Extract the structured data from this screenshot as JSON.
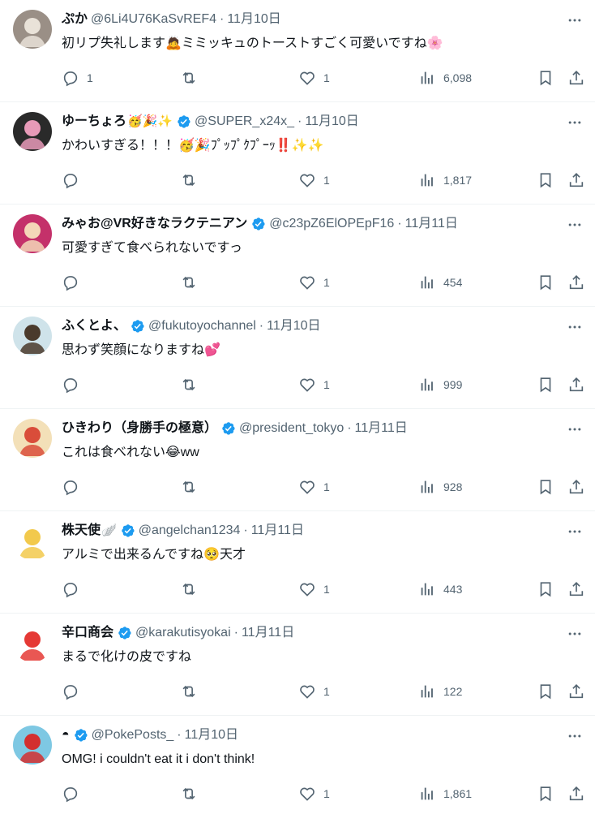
{
  "accent": "#1d9bf0",
  "tweets": [
    {
      "name": "ぷか",
      "name_emoji": "",
      "verified": false,
      "handle": "@6Li4U76KaSvREF4",
      "date": "11月10日",
      "text": "初リプ失礼します🙇ミミッキュのトーストすごく可愛いですね🌸",
      "replies": "1",
      "retweets": "",
      "likes": "1",
      "views": "6,098",
      "avatar": {
        "bg": "#9a8f86",
        "fg": "#e9e2d8",
        "icon": "cat-avatar"
      }
    },
    {
      "name": "ゆーちょろ",
      "name_emoji": "🥳🎉✨",
      "verified": true,
      "handle": "@SUPER_x24x_",
      "date": "11月10日",
      "text": "かわいすぎる！！！🥳🎉ﾌﾟｯﾌﾟｸﾌﾟｰｯ‼️✨✨",
      "replies": "",
      "retweets": "",
      "likes": "1",
      "views": "1,817",
      "avatar": {
        "bg": "#2a2a2a",
        "fg": "#e89ab8",
        "icon": "character-avatar"
      }
    },
    {
      "name": "みゃお@VR好きなラクテニアン",
      "name_emoji": "",
      "verified": true,
      "handle": "@c23pZ6ElOPEpF16",
      "date": "11月11日",
      "text": "可愛すぎて食べられないですっ",
      "replies": "",
      "retweets": "",
      "likes": "1",
      "views": "454",
      "avatar": {
        "bg": "#c4316a",
        "fg": "#f4d7b8",
        "icon": "anime-avatar"
      }
    },
    {
      "name": "ふくとよ、",
      "name_emoji": "",
      "verified": true,
      "handle": "@fukutoyochannel",
      "date": "11月10日",
      "text": "思わず笑顔になりますね💕",
      "replies": "",
      "retweets": "",
      "likes": "1",
      "views": "999",
      "avatar": {
        "bg": "#cfe3ea",
        "fg": "#4a3a2c",
        "icon": "person-avatar"
      }
    },
    {
      "name": "ひきわり（身勝手の極意）",
      "name_emoji": "",
      "verified": true,
      "handle": "@president_tokyo",
      "date": "11月11日",
      "text": "これは食べれない😂ww",
      "replies": "",
      "retweets": "",
      "likes": "1",
      "views": "928",
      "avatar": {
        "bg": "#f3e0b8",
        "fg": "#d94d3a",
        "icon": "doll-avatar"
      }
    },
    {
      "name": "株天使",
      "name_emoji": "🪽",
      "verified": true,
      "handle": "@angelchan1234",
      "date": "11月11日",
      "text": "アルミで出来るんですね🥺天才",
      "replies": "",
      "retweets": "",
      "likes": "1",
      "views": "443",
      "avatar": {
        "bg": "#ffffff",
        "fg": "#f2c94c",
        "icon": "angel-avatar"
      }
    },
    {
      "name": "辛口商会",
      "name_emoji": "",
      "verified": true,
      "handle": "@karakutisyokai",
      "date": "11月11日",
      "text": "まるで化けの皮ですね",
      "replies": "",
      "retweets": "",
      "likes": "1",
      "views": "122",
      "avatar": {
        "bg": "#ffffff",
        "fg": "#e53935",
        "icon": "logo-avatar"
      }
    },
    {
      "name": "◓",
      "name_emoji": "",
      "verified": true,
      "handle": "@PokePosts_",
      "date": "11月10日",
      "text": "OMG! i couldn't eat it i don't think!",
      "replies": "",
      "retweets": "",
      "likes": "1",
      "views": "1,861",
      "avatar": {
        "bg": "#7ec8e3",
        "fg": "#d32f2f",
        "icon": "trainer-avatar"
      }
    }
  ]
}
